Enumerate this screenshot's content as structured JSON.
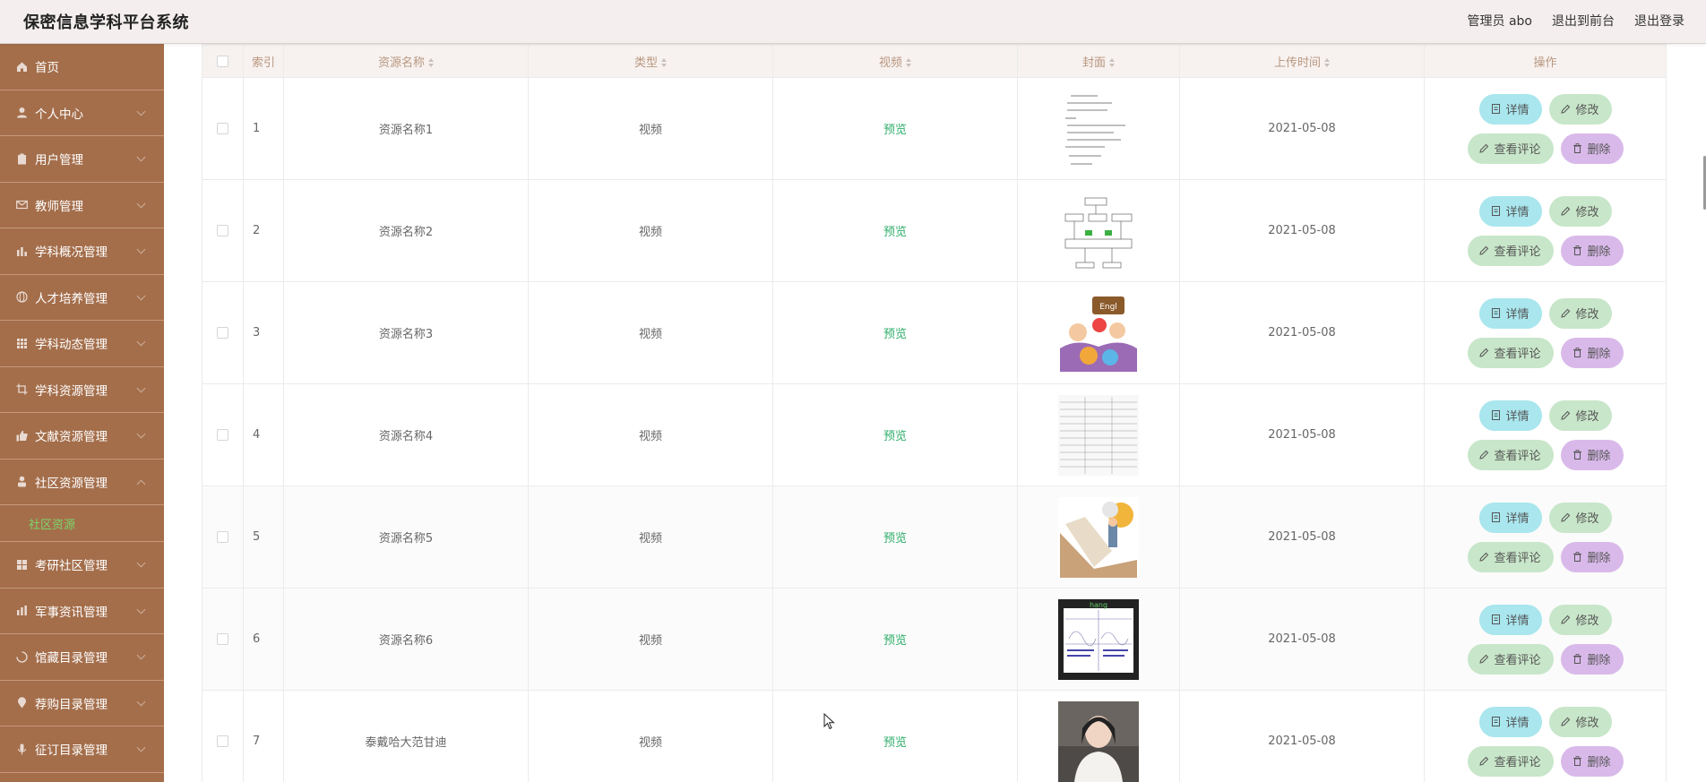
{
  "app": {
    "title": "保密信息学科平台系统"
  },
  "header": {
    "user_label": "管理员 abo",
    "front_link": "退出到前台",
    "logout_link": "退出登录"
  },
  "sidebar": {
    "items": [
      {
        "label": "首页",
        "icon": "home-icon"
      },
      {
        "label": "个人中心",
        "icon": "user-icon"
      },
      {
        "label": "用户管理",
        "icon": "clipboard-icon"
      },
      {
        "label": "教师管理",
        "icon": "mail-icon"
      },
      {
        "label": "学科概况管理",
        "icon": "bar-chart-icon"
      },
      {
        "label": "人才培养管理",
        "icon": "globe-icon"
      },
      {
        "label": "学科动态管理",
        "icon": "grid-icon"
      },
      {
        "label": "学科资源管理",
        "icon": "crop-icon"
      },
      {
        "label": "文献资源管理",
        "icon": "thumb-up-icon"
      },
      {
        "label": "社区资源管理",
        "icon": "person-icon"
      },
      {
        "label": "考研社区管理",
        "icon": "apps-icon"
      },
      {
        "label": "军事资讯管理",
        "icon": "bar-chart-icon"
      },
      {
        "label": "馆藏目录管理",
        "icon": "loading-icon"
      },
      {
        "label": "荐购目录管理",
        "icon": "location-icon"
      },
      {
        "label": "征订目录管理",
        "icon": "mic-icon"
      }
    ],
    "active_sub": "社区资源"
  },
  "table": {
    "headers": {
      "index": "索引",
      "name": "资源名称",
      "type": "类型",
      "video": "视频",
      "cover": "封面",
      "upload_time": "上传时间",
      "ops": "操作"
    },
    "rows": [
      {
        "index": "1",
        "name": "资源名称1",
        "type": "视频",
        "video": "预览",
        "cover": "handwritten-notes",
        "upload_time": "2021-05-08"
      },
      {
        "index": "2",
        "name": "资源名称2",
        "type": "视频",
        "video": "预览",
        "cover": "flow-diagram",
        "upload_time": "2021-05-08"
      },
      {
        "index": "3",
        "name": "资源名称3",
        "type": "视频",
        "video": "预览",
        "cover": "english-cartoon",
        "upload_time": "2021-05-08"
      },
      {
        "index": "4",
        "name": "资源名称4",
        "type": "视频",
        "video": "预览",
        "cover": "text-table",
        "upload_time": "2021-05-08"
      },
      {
        "index": "5",
        "name": "资源名称5",
        "type": "视频",
        "video": "预览",
        "cover": "book-illustration",
        "upload_time": "2021-05-08"
      },
      {
        "index": "6",
        "name": "资源名称6",
        "type": "视频",
        "video": "预览",
        "cover": "math-chart",
        "upload_time": "2021-05-08"
      },
      {
        "index": "7",
        "name": "泰戴哈大范甘迪",
        "type": "视频",
        "video": "预览",
        "cover": "portrait-photo",
        "upload_time": "2021-05-08"
      }
    ],
    "actions": {
      "detail": "详情",
      "edit": "修改",
      "comment": "查看评论",
      "delete": "删除"
    }
  },
  "colors": {
    "sidebar_bg": "#a46e4b",
    "header_bg": "#f4efee",
    "preview_link": "#2fae6b",
    "detail_btn": "#a9e6ee",
    "edit_btn": "#c8e6c9",
    "delete_btn": "#d9b9ea",
    "active_sub": "#7ad66a"
  }
}
